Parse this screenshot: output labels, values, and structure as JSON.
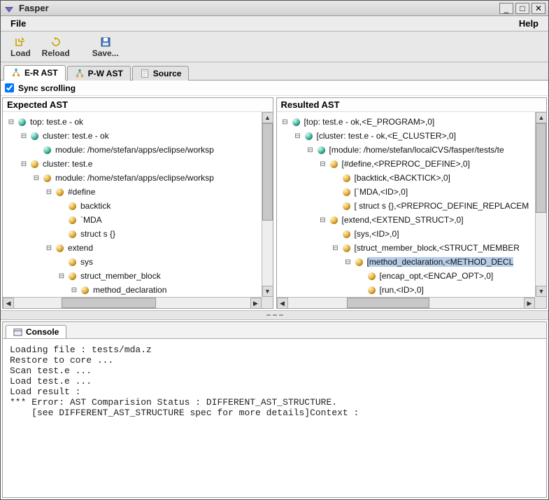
{
  "app": {
    "title": "Fasper"
  },
  "menubar": {
    "file": "File",
    "help": "Help"
  },
  "toolbar": {
    "load": "Load",
    "reload": "Reload",
    "save": "Save..."
  },
  "tabs": {
    "er_ast": "E-R AST",
    "pw_ast": "P-W AST",
    "source": "Source"
  },
  "sync": {
    "label": "Sync scrolling",
    "checked": true
  },
  "panes": {
    "expected_title": "Expected AST",
    "resulted_title": "Resulted AST"
  },
  "expected_tree": {
    "n0": "top: test.e - ok",
    "n1": "cluster: test.e - ok",
    "n2": "module: /home/stefan/apps/eclipse/worksp",
    "n3": "cluster: test.e",
    "n4": "module: /home/stefan/apps/eclipse/worksp",
    "n5": "#define",
    "n6": "backtick",
    "n7": "`MDA",
    "n8": "struct s {}",
    "n9": "extend",
    "n10": "sys",
    "n11": "struct_member_block",
    "n12": "method_declaration"
  },
  "resulted_tree": {
    "n0": "[top: test.e - ok,<E_PROGRAM>,0]",
    "n1": "[cluster: test.e - ok,<E_CLUSTER>,0]",
    "n2": "[module: /home/stefan/localCVS/fasper/tests/te",
    "n3": "[#define,<PREPROC_DEFINE>,0]",
    "n4": "[backtick,<BACKTICK>,0]",
    "n5": "[`MDA,<ID>,0]",
    "n6": "[ struct s {},<PREPROC_DEFINE_REPLACEM",
    "n7": "[extend,<EXTEND_STRUCT>,0]",
    "n8": "[sys,<ID>,0]",
    "n9": "[struct_member_block,<STRUCT_MEMBER",
    "n10": "[method_declaration,<METHOD_DECL",
    "n11": "[encap_opt,<ENCAP_OPT>,0]",
    "n12": "[run,<ID>,0]"
  },
  "console": {
    "tab": "Console",
    "body": "Loading file : tests/mda.z\nRestore to core ...\nScan test.e ...\nLoad test.e ...\nLoad result :\n*** Error: AST Comparision Status : DIFFERENT_AST_STRUCTURE.\n    [see DIFFERENT_AST_STRUCTURE spec for more details]Context :"
  }
}
